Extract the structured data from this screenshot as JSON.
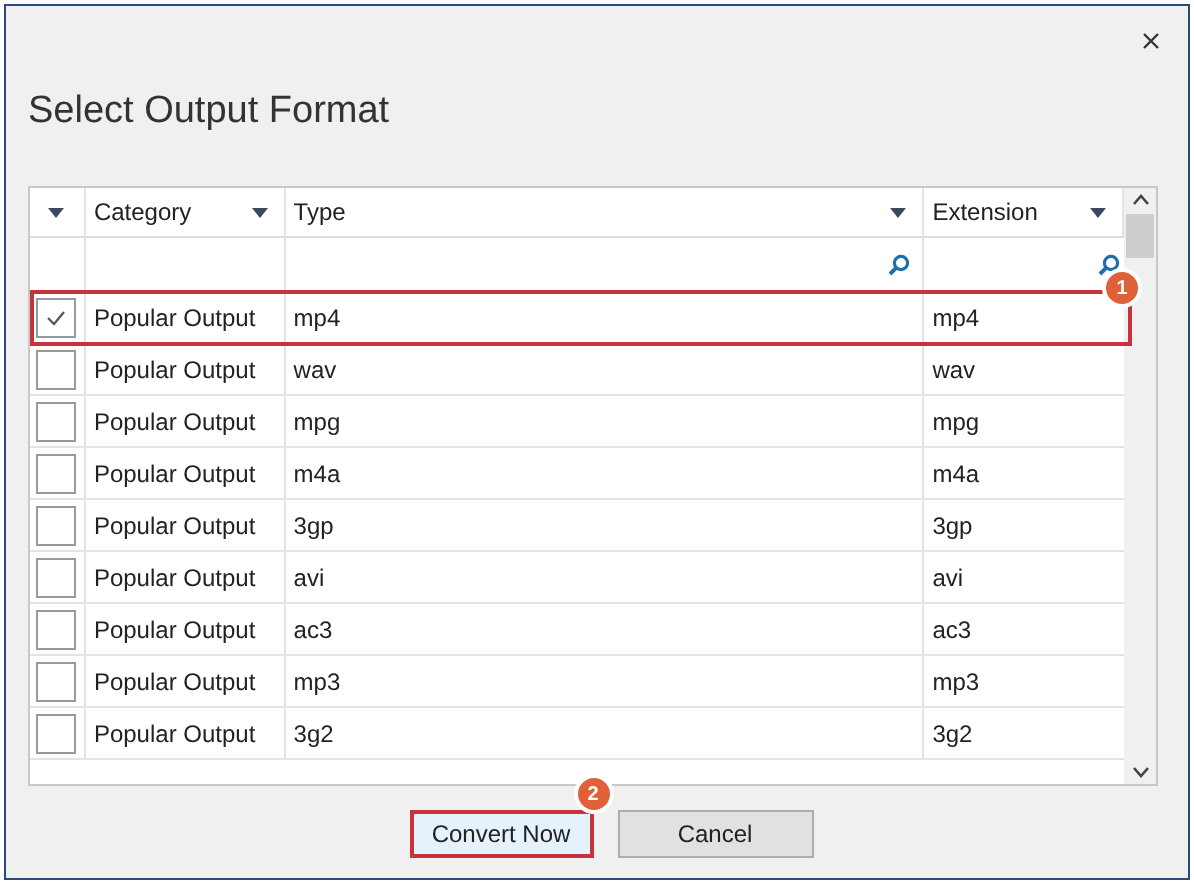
{
  "window": {
    "title": "Select Output Format"
  },
  "table": {
    "columns": [
      {
        "label": "Category"
      },
      {
        "label": "Type"
      },
      {
        "label": "Extension"
      }
    ],
    "rows": [
      {
        "checked": true,
        "highlighted": true,
        "badge": "1",
        "category": "Popular Output",
        "type": "mp4",
        "extension": "mp4"
      },
      {
        "checked": false,
        "highlighted": false,
        "category": "Popular Output",
        "type": "wav",
        "extension": "wav"
      },
      {
        "checked": false,
        "highlighted": false,
        "category": "Popular Output",
        "type": "mpg",
        "extension": "mpg"
      },
      {
        "checked": false,
        "highlighted": false,
        "category": "Popular Output",
        "type": "m4a",
        "extension": "m4a"
      },
      {
        "checked": false,
        "highlighted": false,
        "category": "Popular Output",
        "type": "3gp",
        "extension": "3gp"
      },
      {
        "checked": false,
        "highlighted": false,
        "category": "Popular Output",
        "type": "avi",
        "extension": "avi"
      },
      {
        "checked": false,
        "highlighted": false,
        "category": "Popular Output",
        "type": "ac3",
        "extension": "ac3"
      },
      {
        "checked": false,
        "highlighted": false,
        "category": "Popular Output",
        "type": "mp3",
        "extension": "mp3"
      },
      {
        "checked": false,
        "highlighted": false,
        "category": "Popular Output",
        "type": "3g2",
        "extension": "3g2"
      }
    ]
  },
  "buttons": [
    {
      "label": "Convert Now",
      "highlighted": true,
      "badge": "2"
    },
    {
      "label": "Cancel",
      "highlighted": false
    }
  ]
}
